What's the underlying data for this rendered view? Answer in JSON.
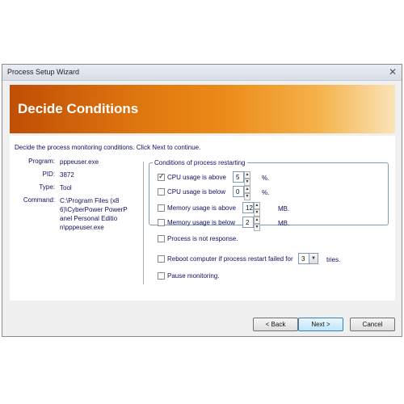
{
  "window": {
    "title": "Process Setup Wizard",
    "close_glyph": "✕"
  },
  "banner": {
    "title": "Decide Conditions"
  },
  "intro": "Decide the process monitoring conditions. Click Next to continue.",
  "info": {
    "program_label": "Program:",
    "program_value": "pppeuser.exe",
    "pid_label": "PID:",
    "pid_value": "3872",
    "type_label": "Type:",
    "type_value": "Tool",
    "command_label": "Command:",
    "command_lines": [
      "C:\\Program Files (x8",
      "6)\\CyberPower PowerP",
      "anel Personal Editio",
      "n\\pppeuser.exe"
    ]
  },
  "conditions": {
    "legend": "Conditions of process restarting",
    "cpu_above": {
      "label": "CPU usage is above",
      "checked": true,
      "value": "5",
      "unit": "%."
    },
    "cpu_below": {
      "label": "CPU usage is below",
      "checked": false,
      "value": "0",
      "unit": "%."
    },
    "mem_above": {
      "label": "Memory usage is above",
      "checked": false,
      "value": "12",
      "unit": "MB."
    },
    "mem_below": {
      "label": "Memory usage is below",
      "checked": false,
      "value": "2",
      "unit": "MB."
    },
    "not_response": {
      "label": "Process is not response.",
      "checked": false
    }
  },
  "reboot": {
    "label": "Reboot computer if process restart failed for",
    "value": "3",
    "suffix": "tries.",
    "checked": false
  },
  "pause": {
    "label": "Pause monitoring.",
    "checked": false
  },
  "spin_glyphs": {
    "up": "▲",
    "down": "▼"
  },
  "buttons": {
    "back": "< Back",
    "next": "Next >",
    "cancel": "Cancel"
  }
}
